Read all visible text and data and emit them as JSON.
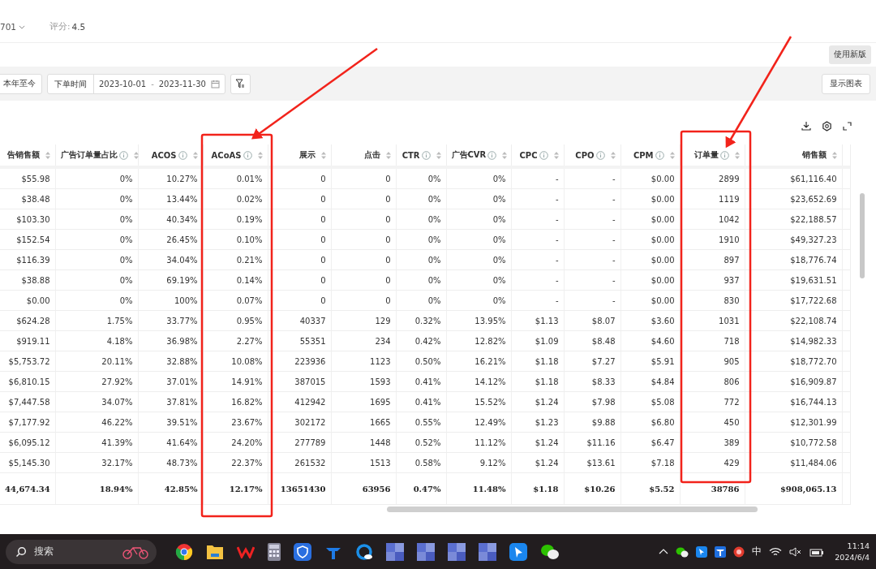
{
  "header": {
    "store_select": "701",
    "rating_label": "评分:",
    "rating_value": "4.5"
  },
  "new_version_button": "使用新版",
  "filters": {
    "preset_button": "本年至今",
    "date_label": "下单时间",
    "start_date": "2023-10-01",
    "separator": "-",
    "end_date": "2023-11-30",
    "chart_button": "显示图表"
  },
  "table": {
    "columns": [
      {
        "label": "告销售额",
        "info": false
      },
      {
        "label": "广告订单量占比",
        "info": true
      },
      {
        "label": "ACOS",
        "info": true
      },
      {
        "label": "ACoAS",
        "info": true
      },
      {
        "label": "展示",
        "info": false
      },
      {
        "label": "点击",
        "info": false
      },
      {
        "label": "CTR",
        "info": true
      },
      {
        "label": "广告CVR",
        "info": true
      },
      {
        "label": "CPC",
        "info": true
      },
      {
        "label": "CPO",
        "info": true
      },
      {
        "label": "CPM",
        "info": true
      },
      {
        "label": "订单量",
        "info": true
      },
      {
        "label": "销售额",
        "info": false
      }
    ],
    "rows": [
      [
        "$55.98",
        "0%",
        "10.27%",
        "0.01%",
        "0",
        "0",
        "0%",
        "0%",
        "-",
        "-",
        "$0.00",
        "2899",
        "$61,116.40"
      ],
      [
        "$38.48",
        "0%",
        "13.44%",
        "0.02%",
        "0",
        "0",
        "0%",
        "0%",
        "-",
        "-",
        "$0.00",
        "1119",
        "$23,652.69"
      ],
      [
        "$103.30",
        "0%",
        "40.34%",
        "0.19%",
        "0",
        "0",
        "0%",
        "0%",
        "-",
        "-",
        "$0.00",
        "1042",
        "$22,188.57"
      ],
      [
        "$152.54",
        "0%",
        "26.45%",
        "0.10%",
        "0",
        "0",
        "0%",
        "0%",
        "-",
        "-",
        "$0.00",
        "1910",
        "$49,327.23"
      ],
      [
        "$116.39",
        "0%",
        "34.04%",
        "0.21%",
        "0",
        "0",
        "0%",
        "0%",
        "-",
        "-",
        "$0.00",
        "897",
        "$18,776.74"
      ],
      [
        "$38.88",
        "0%",
        "69.19%",
        "0.14%",
        "0",
        "0",
        "0%",
        "0%",
        "-",
        "-",
        "$0.00",
        "937",
        "$19,631.51"
      ],
      [
        "$0.00",
        "0%",
        "100%",
        "0.07%",
        "0",
        "0",
        "0%",
        "0%",
        "-",
        "-",
        "$0.00",
        "830",
        "$17,722.68"
      ],
      [
        "$624.28",
        "1.75%",
        "33.77%",
        "0.95%",
        "40337",
        "129",
        "0.32%",
        "13.95%",
        "$1.13",
        "$8.07",
        "$3.60",
        "1031",
        "$22,108.74"
      ],
      [
        "$919.11",
        "4.18%",
        "36.98%",
        "2.27%",
        "55351",
        "234",
        "0.42%",
        "12.82%",
        "$1.09",
        "$8.48",
        "$4.60",
        "718",
        "$14,982.33"
      ],
      [
        "$5,753.72",
        "20.11%",
        "32.88%",
        "10.08%",
        "223936",
        "1123",
        "0.50%",
        "16.21%",
        "$1.18",
        "$7.27",
        "$5.91",
        "905",
        "$18,772.70"
      ],
      [
        "$6,810.15",
        "27.92%",
        "37.01%",
        "14.91%",
        "387015",
        "1593",
        "0.41%",
        "14.12%",
        "$1.18",
        "$8.33",
        "$4.84",
        "806",
        "$16,909.87"
      ],
      [
        "$7,447.58",
        "34.07%",
        "37.81%",
        "16.82%",
        "412942",
        "1695",
        "0.41%",
        "15.52%",
        "$1.24",
        "$7.98",
        "$5.08",
        "772",
        "$16,744.13"
      ],
      [
        "$7,177.92",
        "46.22%",
        "39.51%",
        "23.67%",
        "302172",
        "1665",
        "0.55%",
        "12.49%",
        "$1.23",
        "$9.88",
        "$6.80",
        "450",
        "$12,301.99"
      ],
      [
        "$6,095.12",
        "41.39%",
        "41.64%",
        "24.20%",
        "277789",
        "1448",
        "0.52%",
        "11.12%",
        "$1.24",
        "$11.16",
        "$6.47",
        "389",
        "$10,772.58"
      ],
      [
        "$5,145.30",
        "32.17%",
        "48.73%",
        "22.37%",
        "261532",
        "1513",
        "0.58%",
        "9.12%",
        "$1.24",
        "$13.61",
        "$7.18",
        "429",
        "$11,484.06"
      ]
    ],
    "total": [
      "44,674.34",
      "18.94%",
      "42.85%",
      "12.17%",
      "13651430",
      "63956",
      "0.47%",
      "11.48%",
      "$1.18",
      "$10.26",
      "$5.52",
      "38786",
      "$908,065.13"
    ]
  },
  "taskbar": {
    "search_placeholder": "搜索",
    "ime": "中",
    "time": "11:14",
    "date": "2024/6/4"
  }
}
